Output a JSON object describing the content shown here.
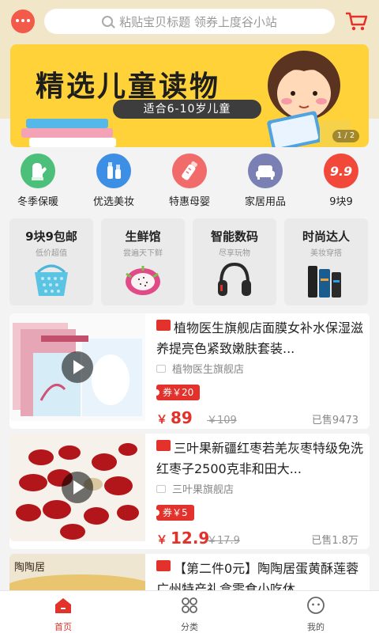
{
  "search": {
    "placeholder": "粘贴宝贝标题  领券上度谷小站"
  },
  "banner": {
    "title": "精选儿童读物",
    "subtitle": "适合6-10岁儿童",
    "pager": "1 / 2"
  },
  "categories": [
    {
      "label": "冬季保暖",
      "icon": "mitten-icon",
      "color": "#4cc07a"
    },
    {
      "label": "优选美妆",
      "icon": "cosmetics-icon",
      "color": "#3d8fe5"
    },
    {
      "label": "特惠母婴",
      "icon": "baby-bottle-icon",
      "color": "#f26b6b"
    },
    {
      "label": "家居用品",
      "icon": "sofa-icon",
      "color": "#7a7fb4"
    },
    {
      "label": "9块9",
      "icon": "nine-nine-icon",
      "color": "#f2483a"
    }
  ],
  "channels": [
    {
      "title": "9块9包邮",
      "sub": "低价超值",
      "icon": "basket-icon"
    },
    {
      "title": "生鲜馆",
      "sub": "尝遍天下鲜",
      "icon": "dragonfruit-icon"
    },
    {
      "title": "智能数码",
      "sub": "尽享玩物",
      "icon": "headphones-icon"
    },
    {
      "title": "时尚达人",
      "sub": "美妆穿搭",
      "icon": "skincare-icon"
    }
  ],
  "products": [
    {
      "title": "植物医生旗舰店面膜女补水保湿滋养提亮色紧致嫩肤套装...",
      "shop": "植物医生旗舰店",
      "coupon": "券￥20",
      "price_symbol": "￥",
      "price": "89",
      "old_price": "￥109",
      "sold": "已售9473"
    },
    {
      "title": "三叶果新疆红枣若羌灰枣特级免洗红枣子2500克非和田大...",
      "shop": "三叶果旗舰店",
      "coupon": "券￥5",
      "price_symbol": "￥",
      "price": "12.9",
      "old_price": "￥17.9",
      "sold": "已售1.8万"
    },
    {
      "title": "【第二件0元】陶陶居蛋黄酥莲蓉广州特产礼盒零食小吃休...",
      "img_text": "陶陶居"
    }
  ],
  "tabs": [
    {
      "label": "首页",
      "icon": "home-icon",
      "active": true
    },
    {
      "label": "分类",
      "icon": "category-icon",
      "active": false
    },
    {
      "label": "我的",
      "icon": "profile-icon",
      "active": false
    }
  ],
  "colors": {
    "accent": "#e3312b",
    "header_bg": "#f2e6c9",
    "banner_bg": "#ffd23a"
  }
}
